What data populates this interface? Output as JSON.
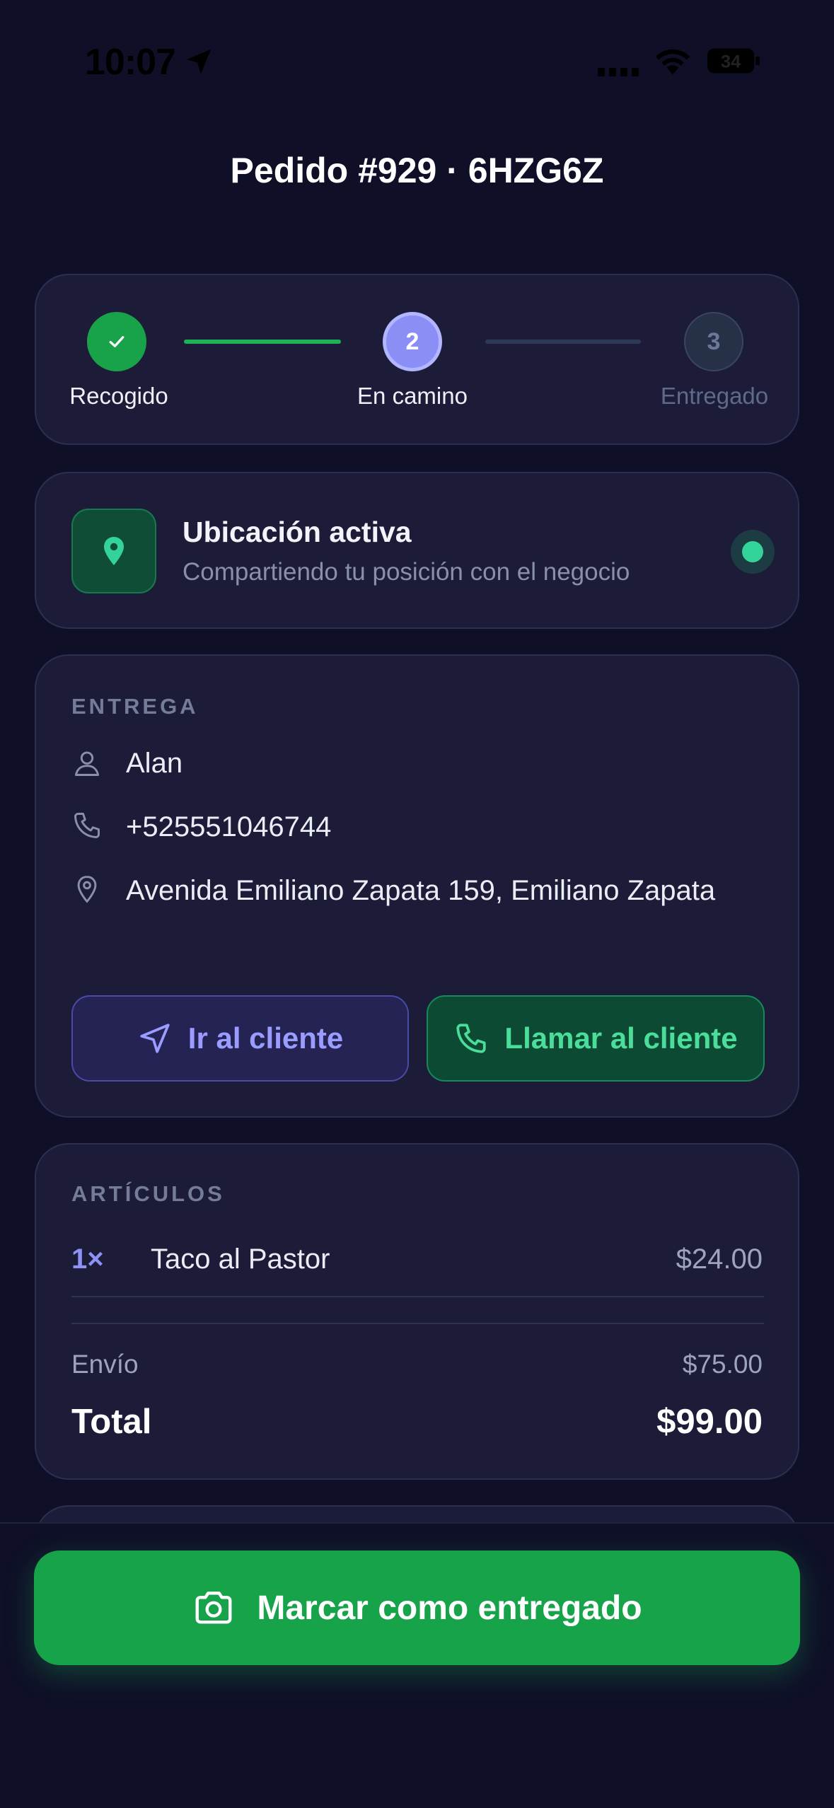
{
  "status_bar": {
    "time": "10:07",
    "battery": "34"
  },
  "header": {
    "title": "Pedido #929 · 6HZG6Z"
  },
  "stepper": {
    "steps": [
      {
        "number": "",
        "label": "Recogido",
        "state": "done"
      },
      {
        "number": "2",
        "label": "En camino",
        "state": "current"
      },
      {
        "number": "3",
        "label": "Entregado",
        "state": "pending"
      }
    ]
  },
  "location": {
    "title": "Ubicación activa",
    "subtitle": "Compartiendo tu posición con el negocio"
  },
  "delivery": {
    "heading": "ENTREGA",
    "customer_name": "Alan",
    "phone": "+525551046744",
    "address": "Avenida Emiliano Zapata 159, Emiliano Zapata",
    "go_button": "Ir al cliente",
    "call_button": "Llamar al cliente"
  },
  "items": {
    "heading": "ARTÍCULOS",
    "list": [
      {
        "qty": "1×",
        "name": "Taco al Pastor",
        "price": "$24.00"
      }
    ],
    "shipping_label": "Envío",
    "shipping_value": "$75.00",
    "total_label": "Total",
    "total_value": "$99.00"
  },
  "actions": {
    "primary_button": "Marcar como entregado"
  },
  "colors": {
    "background": "#0f1028",
    "card": "#1c1c38",
    "success": "#16a34a",
    "accent": "#8a8ef5",
    "call_green": "#4ade9a"
  }
}
